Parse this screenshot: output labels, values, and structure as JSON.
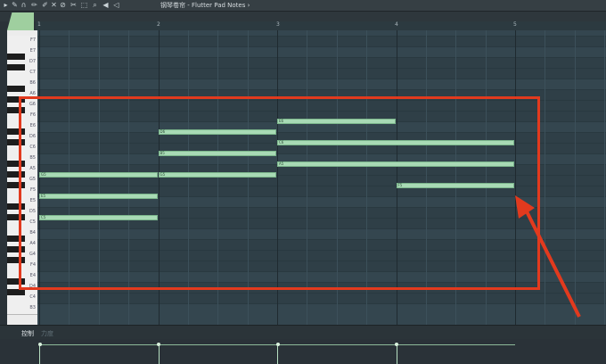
{
  "window": {
    "title": "钢琴卷帘 - Flutter Pad Notes ›"
  },
  "toolbar": {
    "icons": [
      "play-icon",
      "tool-icon",
      "magnet-icon",
      "pencil-icon",
      "paint-icon",
      "delete-icon",
      "mute-icon",
      "slice-icon",
      "select-icon",
      "zoom-icon",
      "playback-icon",
      "speaker-icon"
    ]
  },
  "ruler": {
    "bars": [
      "1",
      "2",
      "3",
      "4",
      "5"
    ]
  },
  "keyboard": {
    "labels": [
      "F7",
      "E7",
      "D7",
      "C7",
      "B6",
      "A6",
      "G6",
      "F6",
      "E6",
      "D6",
      "C6",
      "B5",
      "A5",
      "G5",
      "F5",
      "E5",
      "D5",
      "C5",
      "B4",
      "A4",
      "G4",
      "F4",
      "E4",
      "D4",
      "C4",
      "B3"
    ]
  },
  "notes": [
    {
      "label": "G5",
      "start": 1.0,
      "length": 1.0,
      "pitch": "G5"
    },
    {
      "label": "E5",
      "start": 1.0,
      "length": 1.0,
      "pitch": "E5"
    },
    {
      "label": "C5",
      "start": 1.0,
      "length": 1.0,
      "pitch": "C5"
    },
    {
      "label": "D6",
      "start": 2.0,
      "length": 1.0,
      "pitch": "D6"
    },
    {
      "label": "B5",
      "start": 2.0,
      "length": 1.0,
      "pitch": "B5"
    },
    {
      "label": "G5",
      "start": 2.0,
      "length": 1.0,
      "pitch": "G5"
    },
    {
      "label": "E6",
      "start": 3.0,
      "length": 1.0,
      "pitch": "E6"
    },
    {
      "label": "C6",
      "start": 3.0,
      "length": 2.0,
      "pitch": "C6"
    },
    {
      "label": "A5",
      "start": 3.0,
      "length": 2.0,
      "pitch": "A5"
    },
    {
      "label": "F5",
      "start": 4.0,
      "length": 1.0,
      "pitch": "F5"
    }
  ],
  "control": {
    "label": "控制",
    "sub": "力度"
  }
}
